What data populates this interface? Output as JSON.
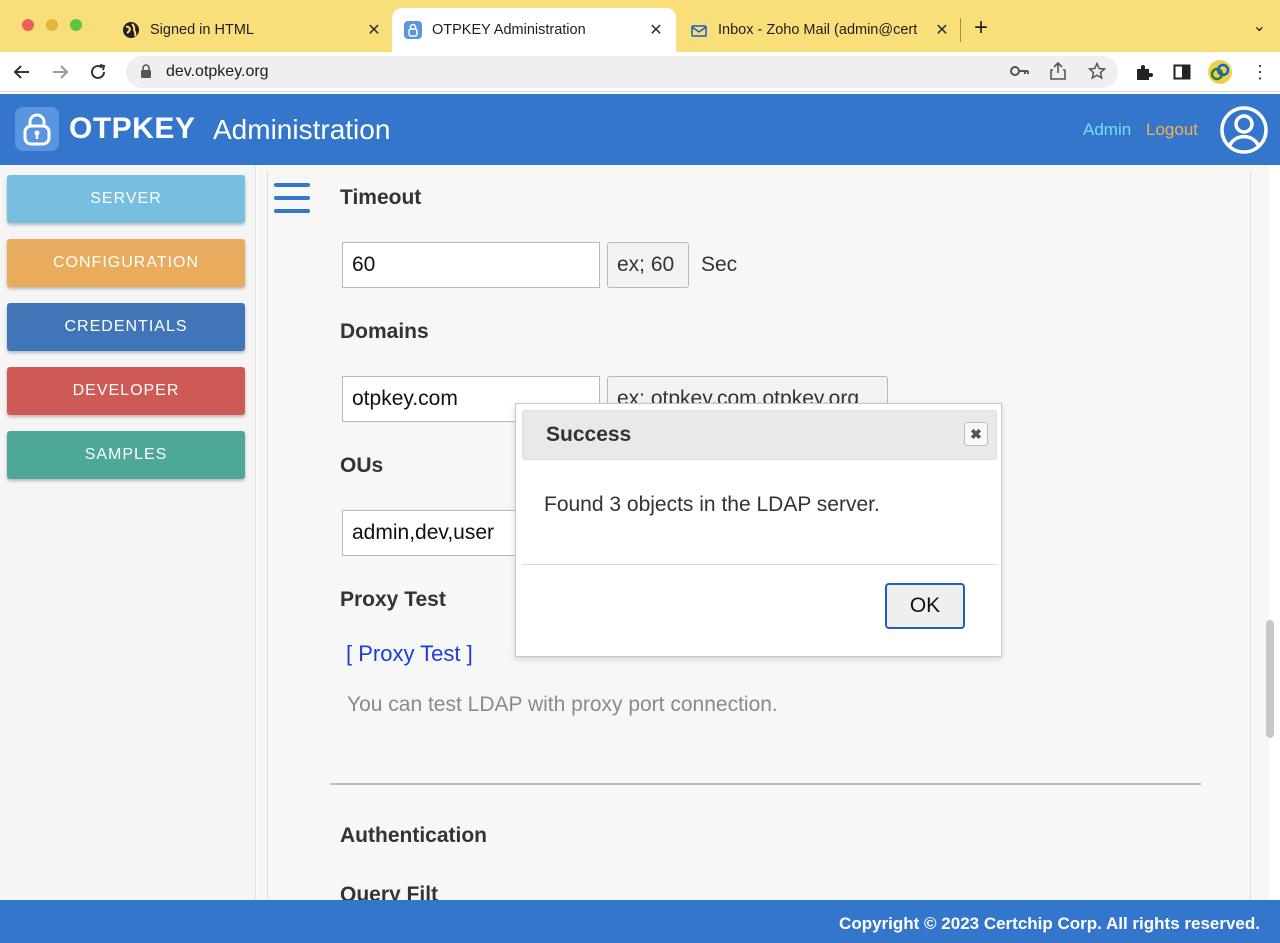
{
  "browser": {
    "tabs": [
      {
        "label": "Signed in HTML",
        "icon": "globe-icon",
        "close": "✕"
      },
      {
        "label": "OTPKEY Administration",
        "icon": "lock-favicon-icon",
        "close": "✕"
      },
      {
        "label": "Inbox - Zoho Mail (admin@cert",
        "icon": "mail-icon",
        "close": "✕"
      }
    ],
    "new_tab": "+",
    "url": "dev.otpkey.org"
  },
  "header": {
    "brand": "OTPKEY",
    "subtitle": "Administration",
    "admin_link": "Admin",
    "logout_link": "Logout"
  },
  "sidebar": {
    "items": [
      {
        "label": "SERVER",
        "color": "#76bfe0"
      },
      {
        "label": "CONFIGURATION",
        "color": "#e8ac5c"
      },
      {
        "label": "CREDENTIALS",
        "color": "#4076b8"
      },
      {
        "label": "DEVELOPER",
        "color": "#ce5a56"
      },
      {
        "label": "SAMPLES",
        "color": "#4ea89a"
      }
    ]
  },
  "content": {
    "timeout": {
      "title": "Timeout",
      "value": "60",
      "hint": "ex; 60",
      "unit": "Sec"
    },
    "domains": {
      "title": "Domains",
      "value": "otpkey.com",
      "hint": "ex; otpkey.com,otpkey.org"
    },
    "ous": {
      "title": "OUs",
      "value": "admin,dev,user"
    },
    "proxy": {
      "title": "Proxy Test",
      "link": "[ Proxy Test ]",
      "note": "You can test LDAP with proxy port connection."
    },
    "authentication": {
      "title": "Authentication"
    },
    "next_section_partial": "Query Filt"
  },
  "footer": {
    "copyright": "Copyright © 2023 Certchip Corp. All rights reserved."
  },
  "modal": {
    "title": "Success",
    "message": "Found 3 objects in the LDAP server.",
    "ok": "OK",
    "close": "✖"
  }
}
